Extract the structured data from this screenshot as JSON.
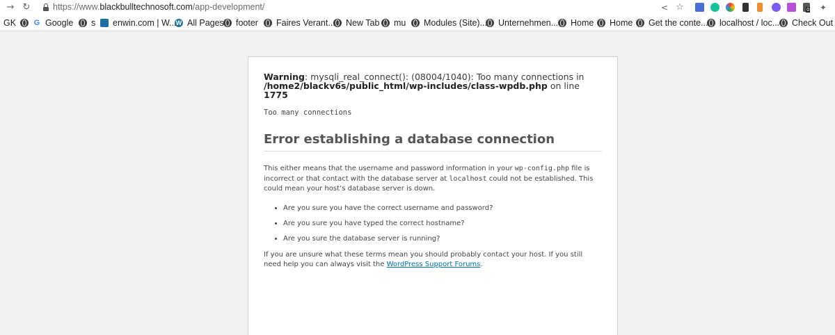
{
  "browser": {
    "url_prefix": "https://www.",
    "url_domain": "blackbulltechnosoft.com",
    "url_path": "/app-development/",
    "icons": [
      "forward-arrow-icon",
      "reload-icon",
      "lock-icon",
      "share-icon",
      "star-icon"
    ],
    "bookmarks": [
      "GK",
      "Google",
      "s",
      "enwin.com | W...",
      "All Pages",
      "footer",
      "Faires Verant...",
      "New Tab",
      "mu",
      "Modules (Site)...",
      "Unternehmen...",
      "Home",
      "Home",
      "Get the conte...",
      "localhost / loc...",
      "Check Out – T"
    ],
    "extension_badge": "0"
  },
  "error_page": {
    "warning_label": "Warning",
    "warning_text": ": mysqli_real_connect(): (08004/1040): Too many connections in",
    "warning_path": "/home2/blackv6s/public_html/wp-includes/class-wpdb.php",
    "on_line_text": " on line ",
    "line_number": "1775",
    "too_many": "Too many connections",
    "heading": "Error establishing a database connection",
    "para1_a": "This either means that the username and password information in your ",
    "para1_code1": "wp-config.php",
    "para1_b": " file is incorrect or that contact with the database server at ",
    "para1_code2": "localhost",
    "para1_c": " could not be established. This could mean your host’s database server is down.",
    "list": [
      "Are you sure you have the correct username and password?",
      "Are you sure you have typed the correct hostname?",
      "Are you sure the database server is running?"
    ],
    "para2_a": "If you are unsure what these terms mean you should probably contact your host. If you still need help you can always visit the ",
    "para2_link": "WordPress Support Forums",
    "para2_b": "."
  }
}
